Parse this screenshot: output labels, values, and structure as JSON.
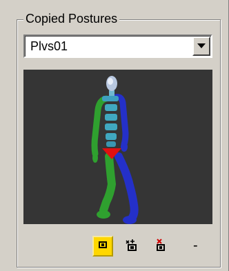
{
  "group": {
    "title": "Copied Postures"
  },
  "dropdown": {
    "selected": "Plvs01"
  },
  "viewport": {
    "background": "#353535"
  },
  "toolbar": {
    "buttons": [
      {
        "name": "copy-posture-button",
        "icon": "posture-copy-icon",
        "active": true
      },
      {
        "name": "paste-posture-button",
        "icon": "posture-paste-icon",
        "active": false
      },
      {
        "name": "delete-posture-button",
        "icon": "posture-delete-icon",
        "active": false
      }
    ],
    "minus_label": "-"
  },
  "colors": {
    "spine": "#40a8c0",
    "left_limbs": "#2fa02f",
    "right_limbs": "#2430c8",
    "pelvis": "#e01010",
    "head": "#b8c8e0",
    "active_button": "#ffd700"
  }
}
